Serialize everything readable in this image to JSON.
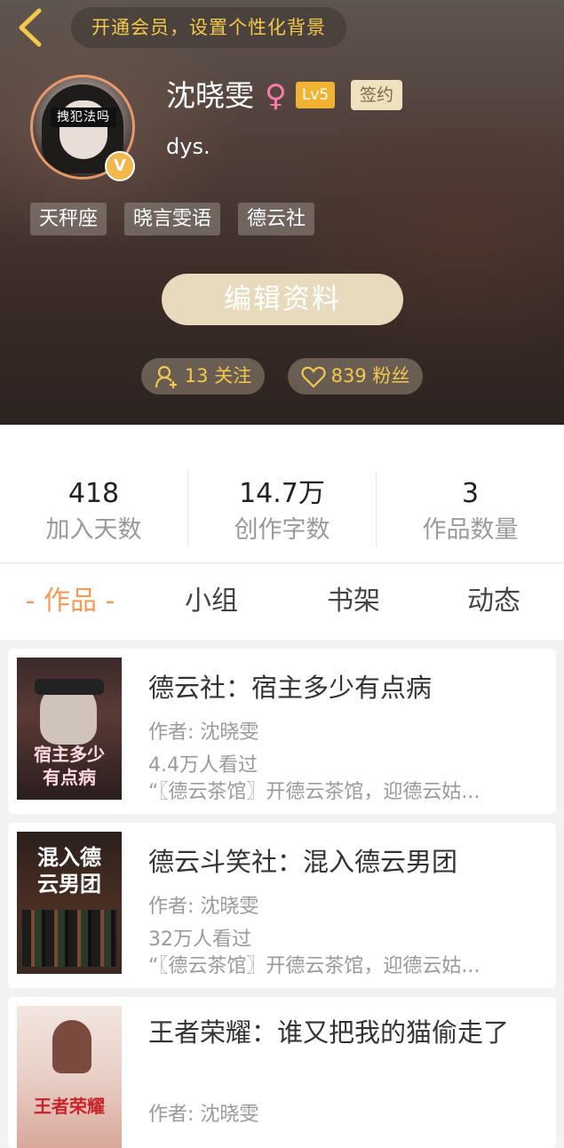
{
  "header": {
    "vip_banner": "开通会员，设置个性化背景",
    "avatar_text": "拽犯法吗",
    "verified_badge": "V",
    "username": "沈晓雯",
    "gender_symbol": "♀",
    "level": "Lv5",
    "signed_badge": "签约",
    "bio": "dys.",
    "tags": [
      "天秤座",
      "晓言雯语",
      "德云社"
    ],
    "edit_button": "编辑资料",
    "following": "13 关注",
    "followers": "839 粉丝"
  },
  "stats": [
    {
      "value": "418",
      "label": "加入天数"
    },
    {
      "value": "14.7万",
      "label": "创作字数"
    },
    {
      "value": "3",
      "label": "作品数量"
    }
  ],
  "tabs": [
    {
      "label": "- 作品 -",
      "active": true
    },
    {
      "label": "小组",
      "active": false
    },
    {
      "label": "书架",
      "active": false
    },
    {
      "label": "动态",
      "active": false
    }
  ],
  "works": [
    {
      "title": "德云社：宿主多少有点病",
      "author": "作者: 沈晓雯",
      "views": "4.4万人看过",
      "desc": "“〖德云茶馆〗开德云茶馆，迎德云姑...",
      "cover_text": "宿主多少有点病"
    },
    {
      "title": "德云斗笑社：混入德云男团",
      "author": "作者: 沈晓雯",
      "views": "32万人看过",
      "desc": "“〖德云茶馆〗开德云茶馆，迎德云姑...",
      "cover_text": "混入德云男团"
    },
    {
      "title": "王者荣耀：谁又把我的猫偷走了",
      "author": "作者: 沈晓雯",
      "views": "",
      "desc": "",
      "cover_text": "王者荣耀"
    }
  ],
  "colors": {
    "accent": "#f29b5a",
    "gold": "#f2c94c",
    "level_bg": "#f2b233"
  }
}
